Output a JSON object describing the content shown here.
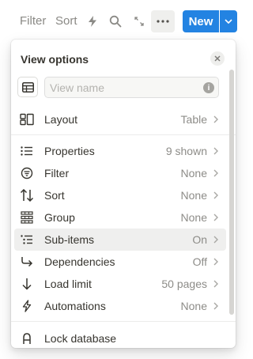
{
  "toolbar": {
    "filter_label": "Filter",
    "sort_label": "Sort",
    "new_label": "New",
    "icons": [
      "lightning-icon",
      "search-icon",
      "expand-icon",
      "more-icon",
      "chevron-down-icon"
    ]
  },
  "panel": {
    "title": "View options",
    "view_name_placeholder": "View name",
    "view_name_value": "",
    "rows": [
      {
        "label": "Layout",
        "value": "Table",
        "icon": "layout-icon"
      },
      {
        "label": "Properties",
        "value": "9 shown",
        "icon": "list-icon"
      },
      {
        "label": "Filter",
        "value": "None",
        "icon": "filter-icon"
      },
      {
        "label": "Sort",
        "value": "None",
        "icon": "sort-icon"
      },
      {
        "label": "Group",
        "value": "None",
        "icon": "group-icon"
      },
      {
        "label": "Sub-items",
        "value": "On",
        "icon": "sub-items-icon"
      },
      {
        "label": "Dependencies",
        "value": "Off",
        "icon": "dependencies-icon"
      },
      {
        "label": "Load limit",
        "value": "50 pages",
        "icon": "arrow-down-icon"
      },
      {
        "label": "Automations",
        "value": "None",
        "icon": "lightning-icon"
      },
      {
        "label": "Lock database",
        "value": "",
        "icon": "lock-icon"
      }
    ]
  },
  "colors": {
    "accent": "#2383e2",
    "text": "#37352f",
    "muted": "#8d8c88",
    "highlight": "#efefee"
  }
}
